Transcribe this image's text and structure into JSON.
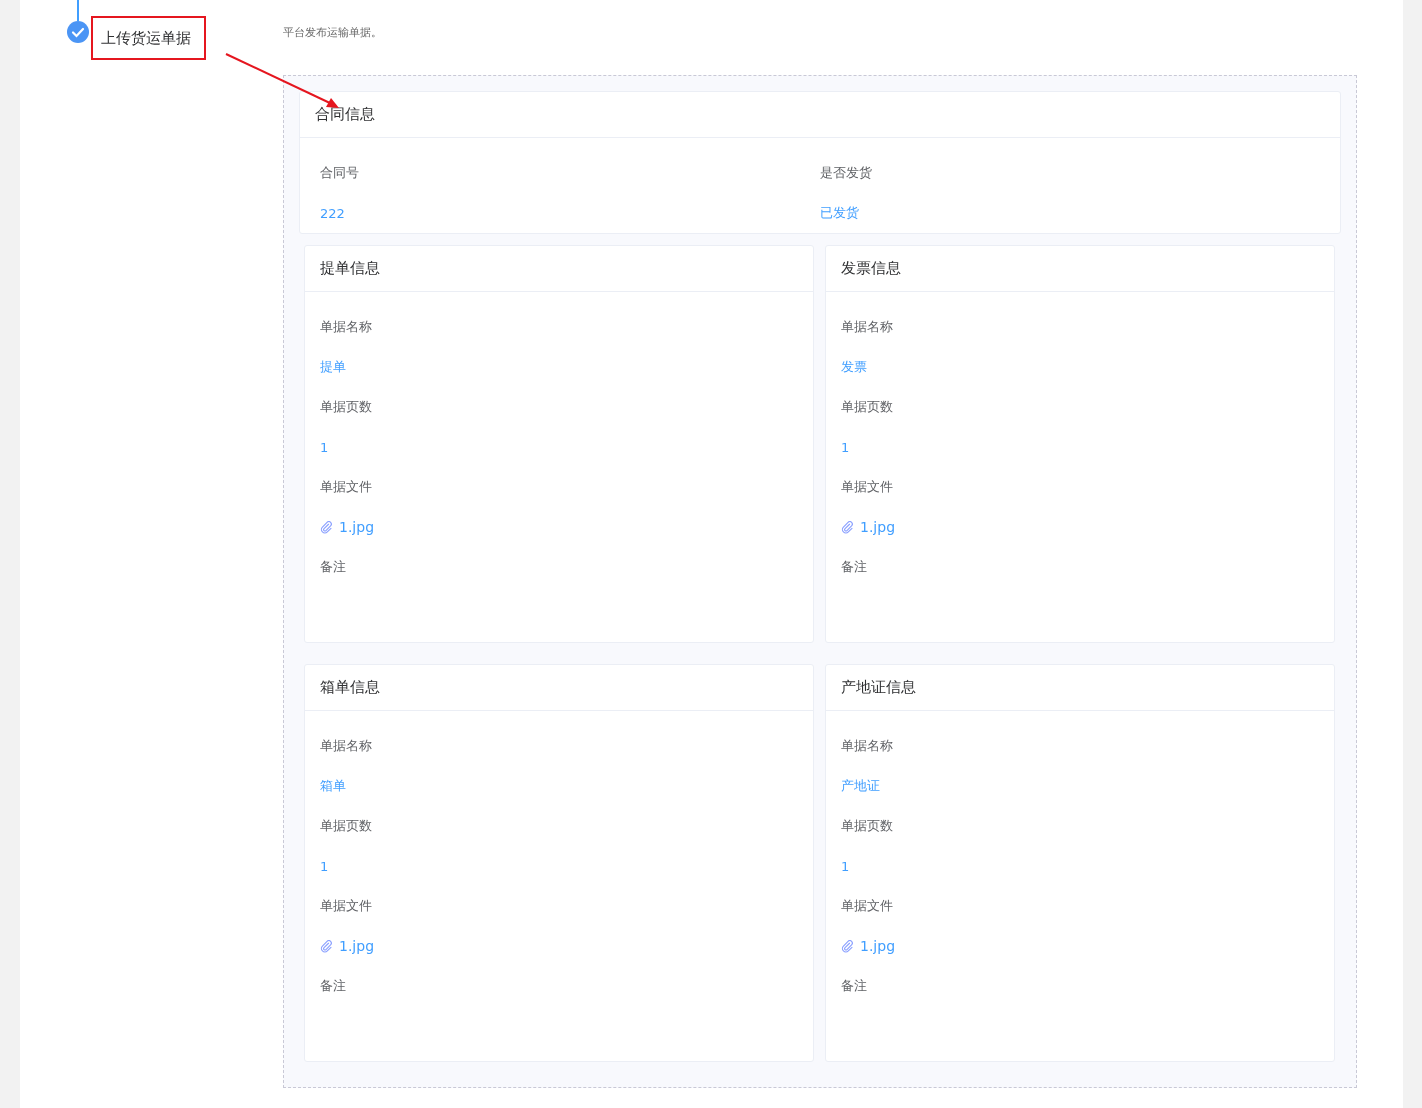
{
  "step": {
    "title": "上传货运单据",
    "completed": true,
    "description": "平台发布运输单据。"
  },
  "contract": {
    "title": "合同信息",
    "fields": [
      {
        "label": "合同号",
        "value": "222"
      },
      {
        "label": "是否发货",
        "value": "已发货"
      }
    ]
  },
  "documents": [
    {
      "title": "提单信息",
      "fields": [
        {
          "kind": "text",
          "label": "单据名称",
          "value": "提单"
        },
        {
          "kind": "text",
          "label": "单据页数",
          "value": "1"
        },
        {
          "kind": "file",
          "label": "单据文件",
          "value": "1.jpg"
        },
        {
          "kind": "empty",
          "label": "备注"
        }
      ]
    },
    {
      "title": "发票信息",
      "fields": [
        {
          "kind": "text",
          "label": "单据名称",
          "value": "发票"
        },
        {
          "kind": "text",
          "label": "单据页数",
          "value": "1"
        },
        {
          "kind": "file",
          "label": "单据文件",
          "value": "1.jpg"
        },
        {
          "kind": "empty",
          "label": "备注"
        }
      ]
    },
    {
      "title": "箱单信息",
      "fields": [
        {
          "kind": "text",
          "label": "单据名称",
          "value": "箱单"
        },
        {
          "kind": "text",
          "label": "单据页数",
          "value": "1"
        },
        {
          "kind": "file",
          "label": "单据文件",
          "value": "1.jpg"
        },
        {
          "kind": "empty",
          "label": "备注"
        }
      ]
    },
    {
      "title": "产地证信息",
      "fields": [
        {
          "kind": "text",
          "label": "单据名称",
          "value": "产地证"
        },
        {
          "kind": "text",
          "label": "单据页数",
          "value": "1"
        },
        {
          "kind": "file",
          "label": "单据文件",
          "value": "1.jpg"
        },
        {
          "kind": "empty",
          "label": "备注"
        }
      ]
    }
  ]
}
